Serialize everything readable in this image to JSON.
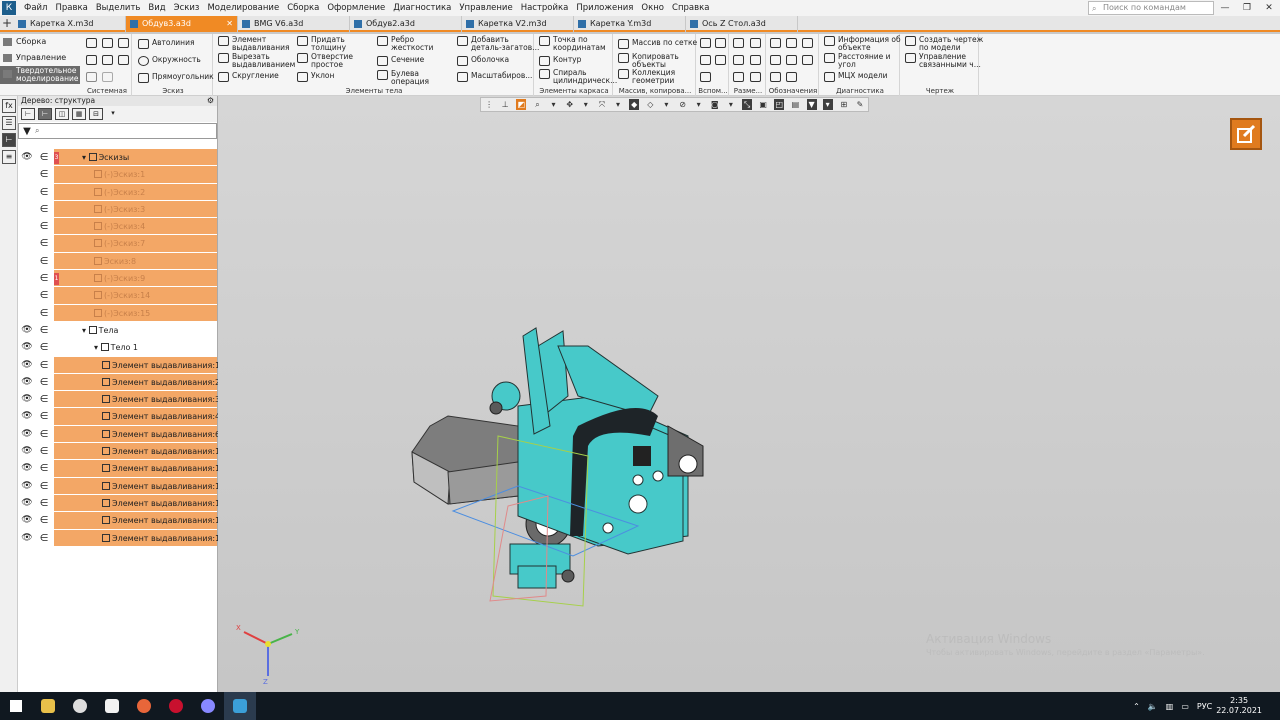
{
  "menu": [
    "Файл",
    "Правка",
    "Выделить",
    "Вид",
    "Эскиз",
    "Моделирование",
    "Сборка",
    "Оформление",
    "Диагностика",
    "Управление",
    "Настройка",
    "Приложения",
    "Окно",
    "Справка"
  ],
  "search_placeholder": "Поиск по командам (Alt+/)",
  "tabs": [
    {
      "label": "Каретка X.m3d",
      "active": false
    },
    {
      "label": "Обдув3.a3d",
      "active": true
    },
    {
      "label": "BMG V6.a3d",
      "active": false
    },
    {
      "label": "Обдув2.a3d",
      "active": false
    },
    {
      "label": "Каретка V2.m3d",
      "active": false
    },
    {
      "label": "Каретка Y.m3d",
      "active": false
    },
    {
      "label": "Ось Z Стол.a3d",
      "active": false
    }
  ],
  "ribbon_left": {
    "assembly": "Сборка",
    "control": "Управление",
    "solid_line1": "Твердотельное",
    "solid_line2": "моделирование"
  },
  "ribbon": {
    "sketch": {
      "autoline": "Автолиния",
      "circle": "Окружность",
      "rect": "Прямоугольник"
    },
    "elements": {
      "extrude1": "Элемент",
      "extrude2": "выдавливания",
      "cut1": "Вырезать",
      "cut2": "выдавливанием",
      "fillet": "Скругление",
      "thick1": "Придать",
      "thick2": "толщину",
      "hole1": "Отверстие",
      "hole2": "простое",
      "draft": "Уклон",
      "rib1": "Ребро",
      "rib2": "жесткости",
      "section": "Сечение",
      "bool1": "Булева",
      "bool2": "операция",
      "add1": "Добавить",
      "add2": "деталь-загатов...",
      "shell": "Оболочка",
      "scale": "Масштабиров..."
    },
    "frame": {
      "point1": "Точка по",
      "point2": "координатам",
      "contour": "Контур",
      "spiral1": "Спираль",
      "spiral2": "цилиндрическ..."
    },
    "arrays": {
      "grid": "Массив по сетке",
      "copy1": "Копировать",
      "copy2": "объекты",
      "coll1": "Коллекция",
      "coll2": "геометрии"
    },
    "diag": {
      "info1": "Информация об",
      "info2": "объекте",
      "dist1": "Расстояние и",
      "dist2": "угол",
      "mcx": "МЦХ модели"
    },
    "drawing": {
      "create1": "Создать чертеж",
      "create2": "по модели",
      "manage1": "Управление",
      "manage2": "связанными ч..."
    },
    "groups": {
      "system": "Системная",
      "sketch": "Эскиз",
      "elements": "Элементы тела",
      "frame": "Элементы каркаса",
      "arrays": "Массив, копирова...",
      "aux": "Вспом...",
      "dims": "Разме...",
      "marks": "Обозначения",
      "diag": "Диагностика",
      "drawing": "Чертеж"
    }
  },
  "tree": {
    "title": "Дерево: структура",
    "rows": [
      {
        "label": "Эскизы",
        "level": 0,
        "dim": false,
        "eye": true,
        "mark": "3"
      },
      {
        "label": "(-)Эскиз:1",
        "level": 1,
        "dim": true,
        "eye": false
      },
      {
        "label": "(-)Эскиз:2",
        "level": 1,
        "dim": true,
        "eye": false
      },
      {
        "label": "(-)Эскиз:3",
        "level": 1,
        "dim": true,
        "eye": false
      },
      {
        "label": "(-)Эскиз:4",
        "level": 1,
        "dim": true,
        "eye": false
      },
      {
        "label": "(-)Эскиз:7",
        "level": 1,
        "dim": true,
        "eye": false
      },
      {
        "label": "Эскиз:8",
        "level": 1,
        "dim": true,
        "eye": false
      },
      {
        "label": "(-)Эскиз:9",
        "level": 1,
        "dim": true,
        "eye": false,
        "mark": "1"
      },
      {
        "label": "(-)Эскиз:14",
        "level": 1,
        "dim": true,
        "eye": false
      },
      {
        "label": "(-)Эскиз:15",
        "level": 1,
        "dim": true,
        "eye": false
      },
      {
        "label": "Тела",
        "level": 0,
        "dim": false,
        "eye": true,
        "nobg": true
      },
      {
        "label": "Тело 1",
        "level": 1,
        "dim": false,
        "eye": true,
        "nobg": true
      },
      {
        "label": "Элемент выдавливания:1",
        "level": 2,
        "dim": false,
        "eye": true
      },
      {
        "label": "Элемент выдавливания:2",
        "level": 2,
        "dim": false,
        "eye": true
      },
      {
        "label": "Элемент выдавливания:3",
        "level": 2,
        "dim": false,
        "eye": true
      },
      {
        "label": "Элемент выдавливания:4",
        "level": 2,
        "dim": false,
        "eye": true
      },
      {
        "label": "Элемент выдавливания:6",
        "level": 2,
        "dim": false,
        "eye": true
      },
      {
        "label": "Элемент выдавливания:10",
        "level": 2,
        "dim": false,
        "eye": true
      },
      {
        "label": "Элемент выдавливания:11",
        "level": 2,
        "dim": false,
        "eye": true
      },
      {
        "label": "Элемент выдавливания:12",
        "level": 2,
        "dim": false,
        "eye": true
      },
      {
        "label": "Элемент выдавливания:13",
        "level": 2,
        "dim": false,
        "eye": true
      },
      {
        "label": "Элемент выдавливания:16",
        "level": 2,
        "dim": false,
        "eye": true
      },
      {
        "label": "Элемент выдавливания:17",
        "level": 2,
        "dim": false,
        "eye": true
      }
    ]
  },
  "watermark": {
    "title": "Активация Windows",
    "sub": "Чтобы активировать Windows, перейдите в раздел «Параметры»."
  },
  "tray": {
    "lang": "РУС",
    "time": "2:35",
    "date": "22.07.2021"
  },
  "colors": {
    "accent": "#f08a24",
    "tree_row": "#f3a766",
    "model": "#47c9c9"
  }
}
